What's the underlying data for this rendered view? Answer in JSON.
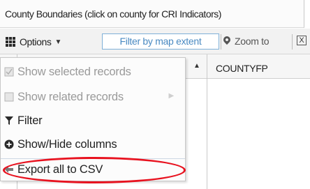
{
  "tab": {
    "title": "County Boundaries (click on county for CRI Indicators)"
  },
  "toolbar": {
    "options_label": "Options",
    "filter_extent_label": "Filter by map extent",
    "zoom_label": "Zoom to",
    "clear_icon": "X"
  },
  "table": {
    "columns": [
      "COUNTYFP"
    ]
  },
  "menu": {
    "items": [
      {
        "label": "Show selected records",
        "icon": "checkbox-icon",
        "enabled": false
      },
      {
        "label": "Show related records",
        "icon": "related-icon",
        "enabled": false,
        "has_submenu": true
      },
      {
        "label": "Filter",
        "icon": "filter-icon",
        "enabled": true
      },
      {
        "label": "Show/Hide columns",
        "icon": "circle-plus-icon",
        "enabled": true
      },
      {
        "label": "Export all to CSV",
        "icon": "export-arrow-icon",
        "enabled": true
      }
    ]
  },
  "annotation": {
    "highlight_color": "#e8121f",
    "highlighted_item": "Export all to CSV"
  }
}
